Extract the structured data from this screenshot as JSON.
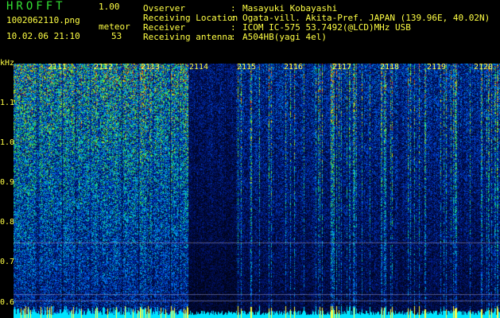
{
  "header": {
    "app_name": "HROFFT",
    "version": "1.00",
    "filename": "1002062110.png",
    "datetime": "10.02.06 21:10",
    "meteor_label": "meteor",
    "meteor_count": "53",
    "info_rows": [
      {
        "label": "Ovserver",
        "value": "Masayuki Kobayashi"
      },
      {
        "label": "Receiving Location",
        "value": "Ogata-vill. Akita-Pref. JAPAN (139.96E, 40.02N)"
      },
      {
        "label": "Receiver",
        "value": "ICOM IC-575 53.7492(@LCD)MHz USB"
      },
      {
        "label": "Receiving antenna",
        "value": "A504HB(yagi 4el)"
      }
    ],
    "separator": ":"
  },
  "spectrogram": {
    "y_unit": "kHz",
    "y_ticks": [
      "1.1",
      "1.0",
      "0.9",
      "0.8",
      "0.7",
      "0.6"
    ],
    "x_ticks": [
      "2111",
      "2112",
      "2113",
      "2114",
      "2115",
      "2116",
      "2117",
      "2118",
      "2119",
      "2120"
    ],
    "colors": {
      "label": "#ffff44",
      "background": "#000000",
      "baseline": "#00e5ff"
    }
  }
}
